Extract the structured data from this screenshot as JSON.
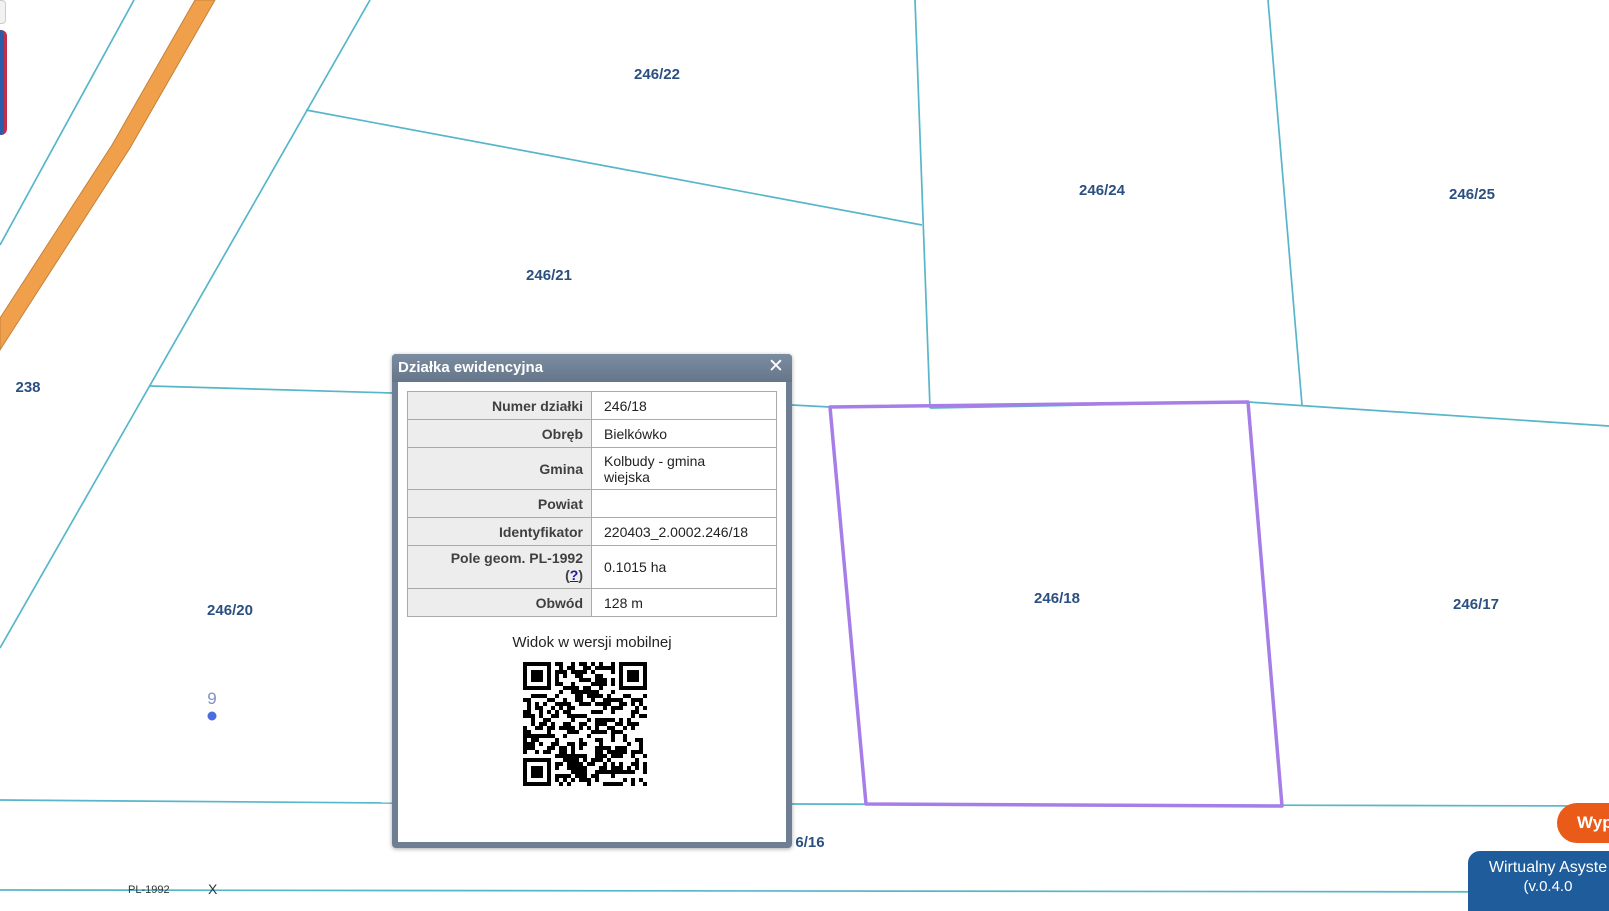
{
  "map": {
    "parcel_labels": [
      "246/22",
      "246/24",
      "246/25",
      "246/21",
      "238",
      "246/20",
      "246/18",
      "246/17",
      "6/16"
    ],
    "point_label": "9",
    "colors": {
      "parcel_line": "#57b6c9",
      "selected_parcel": "#a77ee8",
      "road": "#f0a04b",
      "label": "#2b4f80"
    }
  },
  "popup": {
    "title": "Działka ewidencyjna",
    "close_icon": "close-icon",
    "rows": [
      {
        "key": "Numer działki",
        "value": "246/18"
      },
      {
        "key": "Obręb",
        "value": "Bielkówko"
      },
      {
        "key": "Gmina",
        "value": "Kolbudy - gmina wiejska"
      },
      {
        "key": "Powiat",
        "value": ""
      },
      {
        "key": "Identyfikator",
        "value": "220403_2.0002.246/18"
      },
      {
        "key": "Pole geom. PL-1992",
        "help": "?",
        "value": "0.1015 ha"
      },
      {
        "key": "Obwód",
        "value": "128 m"
      }
    ],
    "mobile_caption": "Widok w wersji mobilnej"
  },
  "buttons": {
    "orange": "Wyp",
    "assistant": "Wirtualny Asyste",
    "assistant_version": "(v.0.4.0"
  },
  "scale": {
    "crs": "PL-1992",
    "x": "X"
  }
}
